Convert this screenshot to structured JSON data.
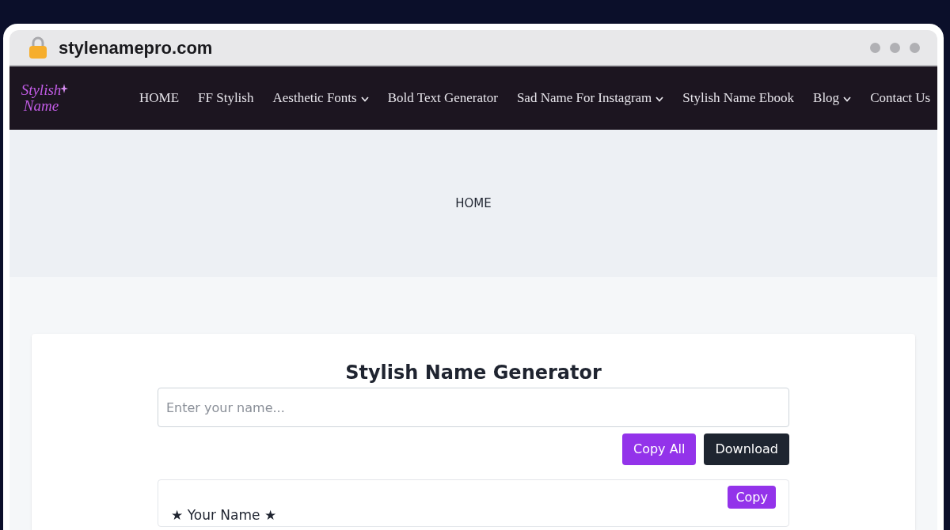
{
  "browser": {
    "url": "stylenamepro.com"
  },
  "nav": {
    "logo": "Stylish Name",
    "items": [
      {
        "label": "HOME",
        "dropdown": false
      },
      {
        "label": "FF Stylish",
        "dropdown": false
      },
      {
        "label": "Aesthetic Fonts",
        "dropdown": true
      },
      {
        "label": "Bold Text Generator",
        "dropdown": false
      },
      {
        "label": "Sad Name For Instagram",
        "dropdown": true
      },
      {
        "label": "Stylish Name Ebook",
        "dropdown": false
      },
      {
        "label": "Blog",
        "dropdown": true
      },
      {
        "label": "Contact Us",
        "dropdown": false
      }
    ]
  },
  "hero": {
    "title": "HOME"
  },
  "generator": {
    "title": "Stylish Name Generator",
    "input": {
      "placeholder": "Enter your name..."
    },
    "buttons": [
      {
        "label": "Copy All",
        "kind": "primary"
      },
      {
        "label": "Download",
        "kind": "dark"
      }
    ],
    "results": [
      {
        "text": "★ Your Name ★",
        "button": "Copy"
      }
    ]
  }
}
